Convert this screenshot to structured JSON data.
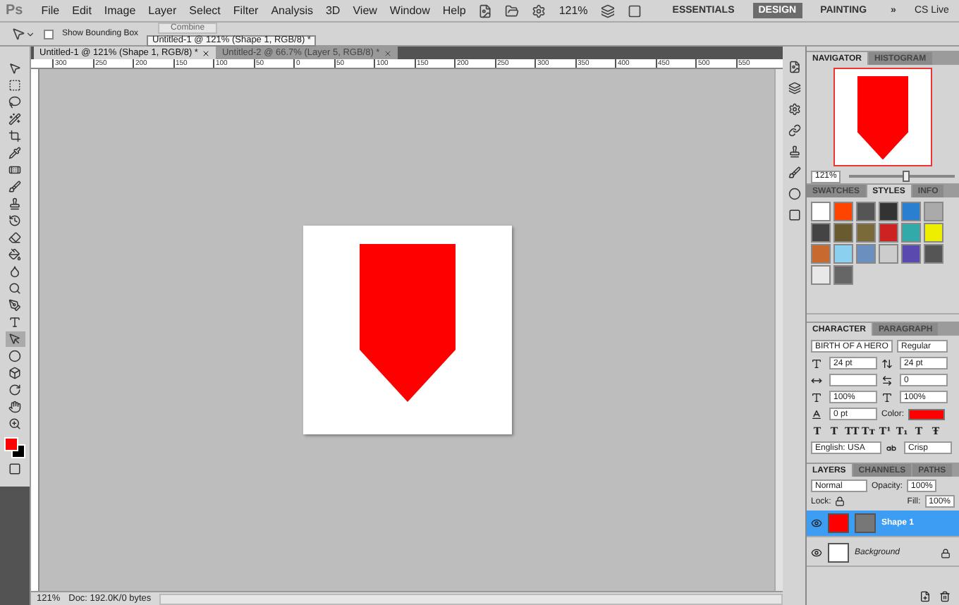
{
  "app_logo": "Ps",
  "menu": [
    "File",
    "Edit",
    "Image",
    "Layer",
    "Select",
    "Filter",
    "Analysis",
    "3D",
    "View",
    "Window",
    "Help"
  ],
  "zoom_level": "121%",
  "workspaces": [
    {
      "label": "ESSENTIALS",
      "selected": false
    },
    {
      "label": "DESIGN",
      "selected": true
    },
    {
      "label": "PAINTING",
      "selected": false
    }
  ],
  "more": "»",
  "cs_live": "CS Live",
  "options_bar": {
    "show_bounding_box": {
      "label": "Show Bounding Box",
      "checked": false
    },
    "combine": "Combine"
  },
  "tooltip": "Untitled-1 @ 121% (Shape 1, RGB/8) *",
  "document_tabs": [
    {
      "label": "Untitled-1 @ 121% (Shape 1, RGB/8) *",
      "selected": true
    },
    {
      "label": "Untitled-2 @ 66.7% (Layer 5, RGB/8) *",
      "selected": false
    }
  ],
  "ruler_labels": [
    "300",
    "250",
    "200",
    "150",
    "100",
    "50",
    "0",
    "50",
    "100",
    "150",
    "200",
    "250",
    "300",
    "350",
    "400",
    "450",
    "500",
    "550"
  ],
  "status_bar": {
    "zoom": "121%",
    "doc": "Doc: 192.0K/0 bytes"
  },
  "navigator": {
    "tabs": [
      {
        "label": "NAVIGATOR",
        "selected": true
      },
      {
        "label": "HISTOGRAM",
        "selected": false
      }
    ],
    "zoom": "121%",
    "level": 0.55
  },
  "styles_panel": {
    "tabs": [
      {
        "label": "SWATCHES",
        "selected": false
      },
      {
        "label": "STYLES",
        "selected": true
      },
      {
        "label": "INFO",
        "selected": false
      }
    ]
  },
  "character": {
    "tabs": [
      {
        "label": "CHARACTER",
        "selected": true
      },
      {
        "label": "PARAGRAPH",
        "selected": false
      }
    ],
    "font": "BIRTH OF A HERO",
    "style": "Regular",
    "size": "24 pt",
    "leading": "24 pt",
    "tracking": "0",
    "vertical_scale": "100%",
    "horizontal_scale": "100%",
    "baseline": "0 pt",
    "color_label": "Color:",
    "color": "#ff0000",
    "style_buttons": [
      "T",
      "T",
      "TT",
      "Tт",
      "T¹",
      "T₁",
      "T",
      "Ŧ"
    ],
    "language": "English: USA",
    "antialias": "Crisp"
  },
  "layers": {
    "tabs": [
      {
        "label": "LAYERS",
        "selected": true
      },
      {
        "label": "CHANNELS",
        "selected": false
      },
      {
        "label": "PATHS",
        "selected": false
      }
    ],
    "blend": "Normal",
    "opacity_label": "Opacity:",
    "opacity": "100%",
    "lock_label": "Lock:",
    "fill_label": "Fill:",
    "fill": "100%",
    "items": [
      {
        "name": "Shape 1",
        "selected": true,
        "kind": "shape"
      },
      {
        "name": "Background",
        "selected": false,
        "kind": "background"
      }
    ]
  }
}
